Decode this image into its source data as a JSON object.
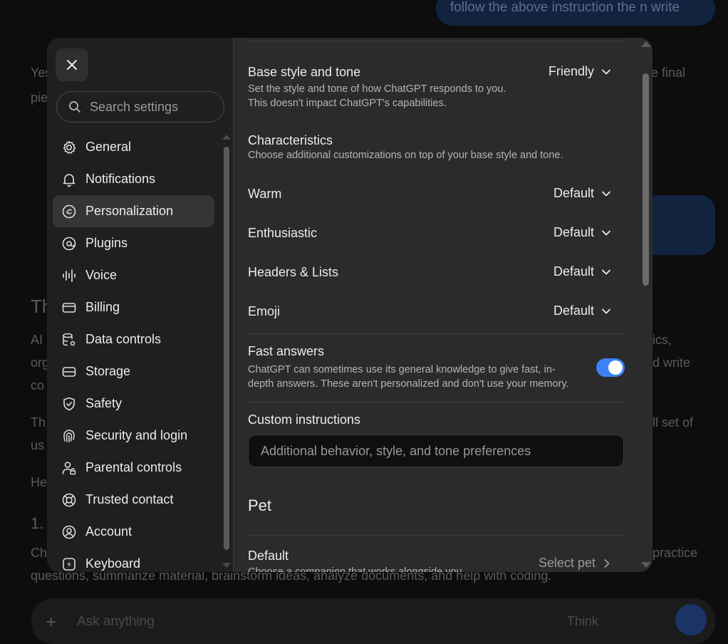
{
  "background": {
    "user_bubble": "follow the above instruction the n write",
    "fragments": [
      {
        "id": "yes",
        "text": "Yes"
      },
      {
        "id": "pie",
        "text": "pie"
      },
      {
        "id": "e-final",
        "text": "e final"
      },
      {
        "id": "th",
        "text": "Th"
      },
      {
        "id": "ai",
        "text": "AI"
      },
      {
        "id": "ics",
        "text": "ics,"
      },
      {
        "id": "org",
        "text": "org"
      },
      {
        "id": "d-write",
        "text": "d write"
      },
      {
        "id": "co",
        "text": "co"
      },
      {
        "id": "th2",
        "text": "Th"
      },
      {
        "id": "ll-set",
        "text": "ll set of"
      },
      {
        "id": "us",
        "text": "us"
      },
      {
        "id": "he",
        "text": "He"
      },
      {
        "id": "one",
        "text": "1."
      },
      {
        "id": "ch",
        "text": "Ch"
      },
      {
        "id": "practice",
        "text": "practice"
      },
      {
        "id": "questions",
        "text": "questions, summarize material, brainstorm ideas, analyze documents, and help with coding."
      }
    ],
    "composer_placeholder": "Ask anything",
    "think_label": "Think"
  },
  "sidebar": {
    "search_placeholder": "Search settings",
    "items": [
      {
        "label": "General",
        "icon": "gear-icon"
      },
      {
        "label": "Notifications",
        "icon": "bell-icon"
      },
      {
        "label": "Personalization",
        "icon": "personalization-icon",
        "active": true
      },
      {
        "label": "Plugins",
        "icon": "plugins-icon"
      },
      {
        "label": "Voice",
        "icon": "voice-icon"
      },
      {
        "label": "Billing",
        "icon": "billing-icon"
      },
      {
        "label": "Data controls",
        "icon": "database-icon"
      },
      {
        "label": "Storage",
        "icon": "storage-icon"
      },
      {
        "label": "Safety",
        "icon": "shield-icon"
      },
      {
        "label": "Security and login",
        "icon": "fingerprint-icon"
      },
      {
        "label": "Parental controls",
        "icon": "parental-icon"
      },
      {
        "label": "Trusted contact",
        "icon": "lifebuoy-icon"
      },
      {
        "label": "Account",
        "icon": "account-icon"
      },
      {
        "label": "Keyboard",
        "icon": "keyboard-icon"
      }
    ]
  },
  "content": {
    "base_style": {
      "title": "Base style and tone",
      "desc_line1": "Set the style and tone of how ChatGPT responds to you.",
      "desc_line2": "This doesn't impact ChatGPT's capabilities.",
      "value": "Friendly"
    },
    "characteristics": {
      "title": "Characteristics",
      "desc": "Choose additional customizations on top of your base style and tone.",
      "rows": [
        {
          "label": "Warm",
          "value": "Default"
        },
        {
          "label": "Enthusiastic",
          "value": "Default"
        },
        {
          "label": "Headers & Lists",
          "value": "Default"
        },
        {
          "label": "Emoji",
          "value": "Default"
        }
      ]
    },
    "fast_answers": {
      "title": "Fast answers",
      "desc_line1": "ChatGPT can sometimes use its general knowledge to give fast, in-",
      "desc_line2": "depth answers. These aren't personalized and don't use your memory.",
      "enabled": true
    },
    "custom_instructions": {
      "title": "Custom instructions",
      "placeholder": "Additional behavior, style, and tone preferences"
    },
    "pet": {
      "heading": "Pet",
      "title": "Default",
      "desc": "Choose a companion that works alongside you",
      "action": "Select pet"
    }
  },
  "colors": {
    "accent": "#3b82f6",
    "modal_bg": "#2b2b2b",
    "sidebar_bg": "#1f1f1f"
  }
}
